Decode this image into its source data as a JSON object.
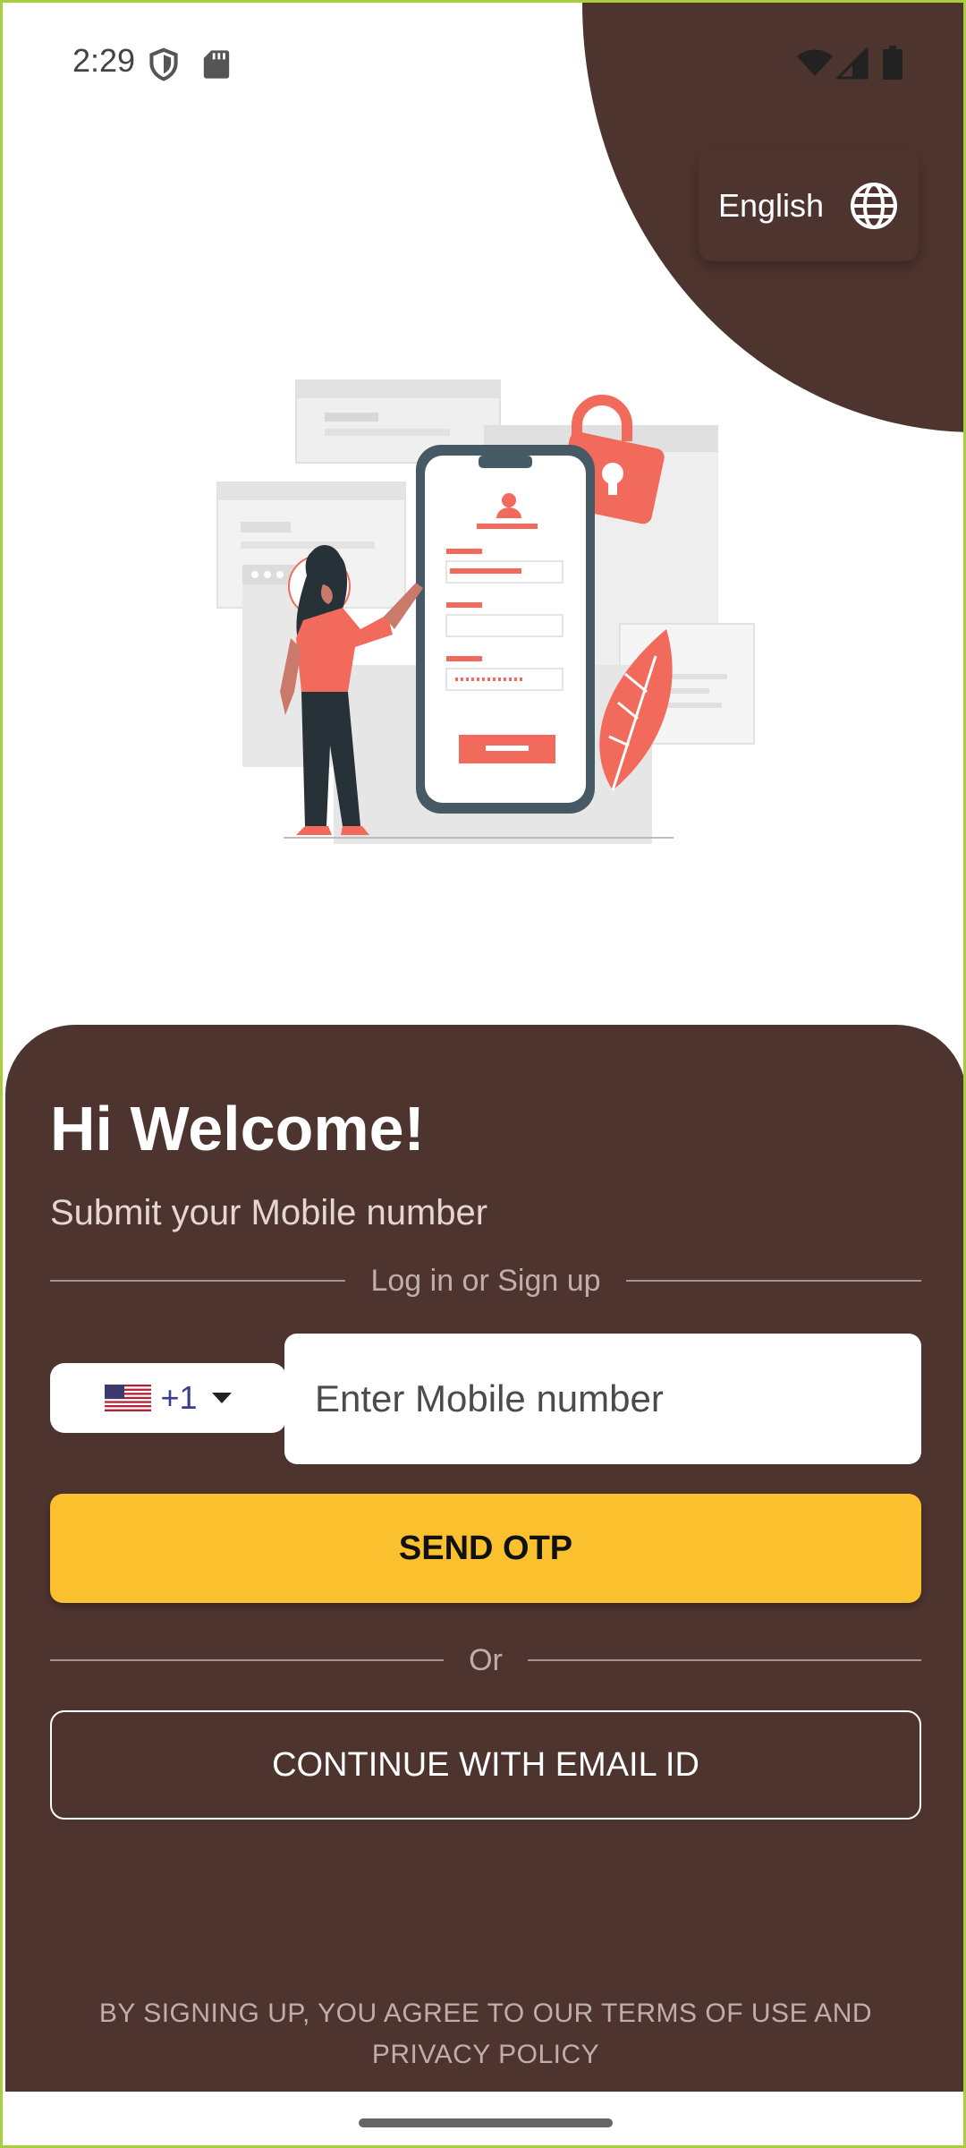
{
  "status_bar": {
    "time": "2:29",
    "icons": [
      "shield-icon",
      "sd-card-icon",
      "wifi-icon",
      "signal-icon",
      "battery-icon"
    ]
  },
  "language": {
    "label": "English",
    "icon": "globe-icon"
  },
  "welcome": {
    "title": "Hi Welcome!",
    "subtitle": "Submit your Mobile number",
    "divider_text": "Log in or Sign up"
  },
  "phone": {
    "country_code": "+1",
    "flag": "us-flag-icon",
    "placeholder": "Enter Mobile number",
    "value": ""
  },
  "actions": {
    "send_otp": "SEND OTP",
    "or_text": "Or",
    "continue_email": "CONTINUE WITH EMAIL ID"
  },
  "footer": {
    "terms": "BY SIGNING UP, YOU AGREE TO OUR TERMS OF USE AND PRIVACY POLICY"
  },
  "colors": {
    "brand_brown": "#4e342e",
    "accent_yellow": "#fbc02d",
    "illustration_coral": "#f26a5b"
  }
}
